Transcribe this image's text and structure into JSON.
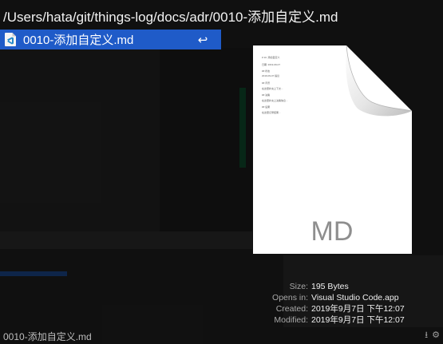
{
  "path_bar": {
    "text": "/Users/hata/git/things-log/docs/adr/0010-添加自定义.md"
  },
  "results": [
    {
      "name": "0010-添加自定义.md",
      "icon": "vscode-markdown-file-icon",
      "action_icon": "return-icon",
      "action_glyph": "↩"
    }
  ],
  "preview": {
    "extension": "MD",
    "document_lines": [
      "# 10. 添加自定义",
      "日期: 2019-09-07",
      "## 状态",
      "2019-09-07 提议",
      "## 背景",
      "在这里补充上下文...",
      "## 决策",
      "在这里补充上决策信息...",
      "## 后果",
      "在这里记录结果..."
    ]
  },
  "info": [
    {
      "label": "Size:",
      "value": "195 Bytes"
    },
    {
      "label": "Opens in:",
      "value": "Visual Studio Code.app"
    },
    {
      "label": "Created:",
      "value": "2019年9月7日 下午12:07"
    },
    {
      "label": "Modified:",
      "value": "2019年9月7日 下午12:07"
    }
  ],
  "footer": {
    "name": "0010-添加自定义.md",
    "icons": [
      {
        "name": "download-arrow-icon",
        "glyph": "⭳"
      },
      {
        "name": "gear-icon",
        "glyph": "⚙"
      }
    ]
  },
  "colors": {
    "selection": "#1f5bc8",
    "background": "#1a1a1a",
    "vscode_blue": "#2489ca"
  }
}
